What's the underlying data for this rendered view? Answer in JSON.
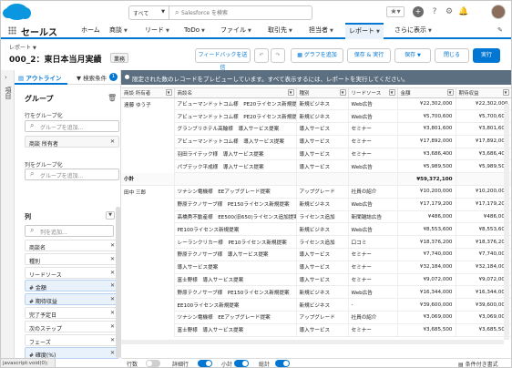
{
  "header": {
    "search_scope": "すべて",
    "search_placeholder": "Salesforce を検索",
    "icons": [
      "favorites-icon",
      "add-icon",
      "help-icon",
      "setup-icon",
      "notifications-icon"
    ]
  },
  "nav": {
    "app_name": "セールス",
    "tabs": [
      "ホーム",
      "商談",
      "リード",
      "ToDo",
      "ファイル",
      "取引先",
      "担当者",
      "レポート",
      "さらに表示"
    ]
  },
  "title": {
    "object_label": "レポート",
    "name": "000_2：東日本当月実績",
    "badge": "業務"
  },
  "toolbar": {
    "feedback": "フィードバックを送信",
    "add_chart": "グラフを追加",
    "save_run": "保存 & 実行",
    "save": "保存",
    "close": "閉じる",
    "run": "実行"
  },
  "rail": {
    "label": "項目"
  },
  "panel": {
    "tab_outline": "アウトライン",
    "tab_filter": "検索条件",
    "filter_count": "1",
    "groups_heading": "グループ",
    "row_group_label": "行をグループ化",
    "row_group_placeholder": "グループを追加...",
    "row_group_pill": "商談 所有者",
    "col_group_label": "列をグループ化",
    "col_group_placeholder": "グループを追加...",
    "columns_heading": "列",
    "columns_placeholder": "列を追加...",
    "columns": [
      {
        "label": "商談名",
        "num": false
      },
      {
        "label": "種別",
        "num": false
      },
      {
        "label": "リードソース",
        "num": false
      },
      {
        "label": "# 金額",
        "num": true
      },
      {
        "label": "# 期待収益",
        "num": true
      },
      {
        "label": "完了予定日",
        "num": false
      },
      {
        "label": "次のステップ",
        "num": false
      },
      {
        "label": "フェーズ",
        "num": false
      },
      {
        "label": "# 確度(%)",
        "num": true
      }
    ]
  },
  "preview": {
    "message": "限定された数のレコードをプレビューしています。すべて表示するには、レポートを実行してください。"
  },
  "table": {
    "headers": [
      "商談 所有者",
      "商談名",
      "種別",
      "リードソース",
      "金額",
      "期待収益"
    ],
    "groups": [
      {
        "owner": "遠藤 ゆう子",
        "rows": [
          [
            "アビューマンドットコム様　PE20ライセンス新規提案",
            "新規ビジネス",
            "Web広告",
            "¥22,302,000",
            "¥22,302,000"
          ],
          [
            "アビューマンドットコム様　PE20ライセンス新規提案",
            "新規ビジネス",
            "Web広告",
            "¥5,700,600",
            "¥5,700,600"
          ],
          [
            "グランブリホテル高輪様　導入サービス提案",
            "導入サービス",
            "セミナー",
            "¥3,801,600",
            "¥3,801,600"
          ],
          [
            "アビューマンドットコム様　導入サービス提案",
            "導入サービス",
            "セミナー",
            "¥17,892,000",
            "¥17,892,000"
          ],
          [
            "羽田ライテック様　導入サービス提案",
            "導入サービス",
            "セミナー",
            "¥3,686,400",
            "¥3,686,400"
          ],
          [
            "パブテック平成様　導入サービス提案",
            "導入サービス",
            "Web広告",
            "¥5,989,500",
            "¥5,989,500"
          ]
        ],
        "subtotal": "¥59,372,100"
      },
      {
        "owner": "田中 三郎",
        "rows": [
          [
            "ツナシン電機様　EEアップグレード提案",
            "アップグレード",
            "社員の紹介",
            "¥10,200,000",
            "¥10,200,000"
          ],
          [
            "野原テクノサーブ様　PE150ライセンス新規提案",
            "新規ビジネス",
            "Web広告",
            "¥17,179,200",
            "¥17,179,200"
          ],
          [
            "高橋秀不動産様　EE500(旧650)ライセンス追加提案",
            "ライセンス追加",
            "新聞雑誌広告",
            "¥486,000",
            "¥486,000"
          ],
          [
            "PE100ライセンス新規提案",
            "新規ビジネス",
            "Web広告",
            "¥8,553,600",
            "¥8,553,600"
          ],
          [
            "レーランクリカー様　PE10ライセンス新規提案",
            "ライセンス追加",
            "口コミ",
            "¥18,376,200",
            "¥18,376,200"
          ],
          [
            "野原テクノサーブ様　導入サービス提案",
            "導入サービス",
            "セミナー",
            "¥7,740,000",
            "¥7,740,000"
          ],
          [
            "導入サービス提案",
            "導入サービス",
            "セミナー",
            "¥32,184,000",
            "¥32,184,000"
          ],
          [
            "富士野様　導入サービス提案",
            "導入サービス",
            "セミナー",
            "¥9,072,000",
            "¥9,072,000"
          ],
          [
            "野原テクノサーブ様　PE150ライセンス新規提案",
            "新規ビジネス",
            "Web広告",
            "¥16,344,000",
            "¥16,344,000"
          ],
          [
            "EE100ライセンス新規提案",
            "新規ビジネス",
            "-",
            "¥39,600,000",
            "¥39,600,000"
          ],
          [
            "ツナシン電機様　EEアップグレード提案",
            "アップグレード",
            "社員の紹介",
            "¥3,069,000",
            "¥3,069,000"
          ],
          [
            "富士野様　導入サービス提案",
            "導入サービス",
            "セミナー",
            "¥3,685,500",
            "¥3,685,500"
          ]
        ]
      }
    ],
    "subtotal_label": "小計"
  },
  "footer": {
    "row_count": "行数",
    "detail_rows": "詳細行",
    "subtotals": "小計",
    "grand_total": "総計",
    "conditional_format": "条件付き書式"
  },
  "status": "javascript:void(0);"
}
